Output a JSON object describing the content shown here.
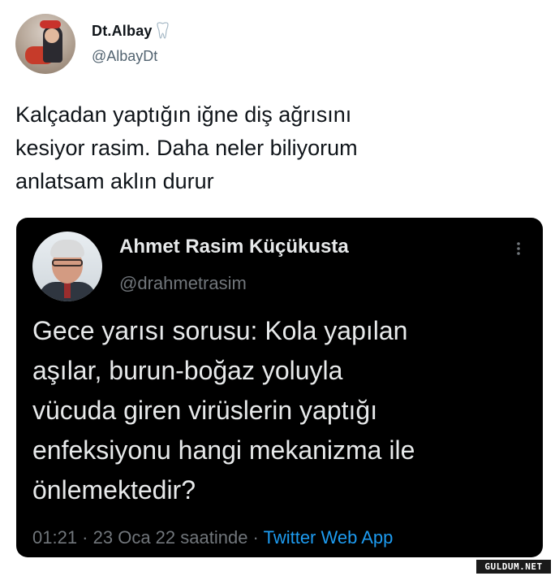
{
  "tweet": {
    "author": {
      "display_name": "Dt.Albay",
      "handle": "@AlbayDt",
      "name_emoji": "tooth-icon"
    },
    "text_lines": [
      "Kalçadan yaptığın iğne diş ağrısını",
      "kesiyor rasim. Daha neler biliyorum",
      "anlatsam aklın durur"
    ]
  },
  "embedded_tweet": {
    "author": {
      "display_name": "Ahmet Rasim Küçükusta",
      "handle": "@drahmetrasim"
    },
    "text_lines": [
      "Gece yarısı sorusu: Kola yapılan",
      "aşılar, burun-boğaz yoluyla",
      "vücuda giren virüslerin yaptığı",
      "enfeksiyonu hangi mekanizma ile",
      "önlemektedir?"
    ],
    "meta": {
      "time": "01:21",
      "sep1": " · ",
      "date": "23 Oca 22 saatinde",
      "sep2": " · ",
      "source": "Twitter Web App"
    },
    "more_icon": "more-vertical-icon"
  },
  "watermark": {
    "text": "GULDUM.NET"
  },
  "colors": {
    "text_primary": "#0f1419",
    "text_secondary": "#536471",
    "embed_bg": "#000000",
    "link": "#1d9bf0"
  }
}
